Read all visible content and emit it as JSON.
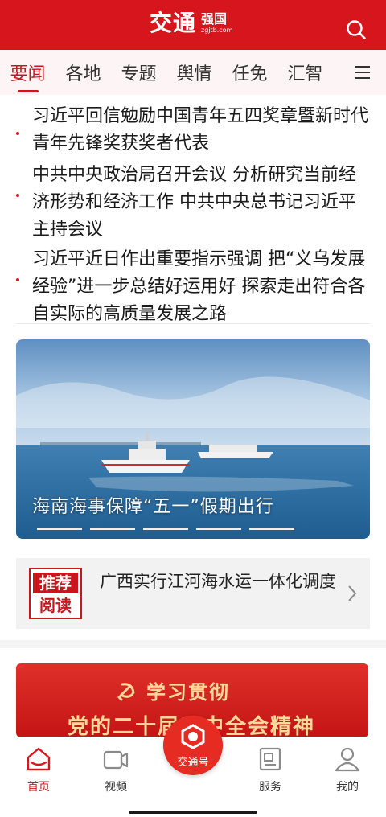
{
  "header": {
    "logo_main": "交通",
    "logo_sub": "强国",
    "logo_url": "zgjtb.com"
  },
  "tabs": [
    {
      "label": "要闻",
      "active": true
    },
    {
      "label": "各地"
    },
    {
      "label": "专题"
    },
    {
      "label": "舆情"
    },
    {
      "label": "任免"
    },
    {
      "label": "汇智"
    }
  ],
  "news": [
    {
      "title": "习近平回信勉励中国青年五四奖章暨新时代青年先锋奖获奖者代表"
    },
    {
      "title": "中共中央政治局召开会议 分析研究当前经济形势和经济工作 中共中央总书记习近平主持会议"
    },
    {
      "title": "习近平近日作出重要指示强调 把“义乌发展经验”进一步总结好运用好 探索走出符合各自实际的高质量发展之路"
    }
  ],
  "banner": {
    "caption": "海南海事保障“五一”假期出行",
    "slides": 5
  },
  "recommend": {
    "badge_line1": "推荐",
    "badge_line2": "阅读",
    "text": "广西实行江河海水运一体化调度"
  },
  "promo": {
    "line1": "学习贯彻",
    "line2": "党的二十届三中全会精神"
  },
  "bottom_nav": {
    "home": "首页",
    "video": "视频",
    "center": "交通号",
    "service": "服务",
    "mine": "我的"
  },
  "colors": {
    "brand_red": "#d6161c",
    "tab_bg": "#fdf5f5",
    "promo_gold": "#ffd89a"
  }
}
